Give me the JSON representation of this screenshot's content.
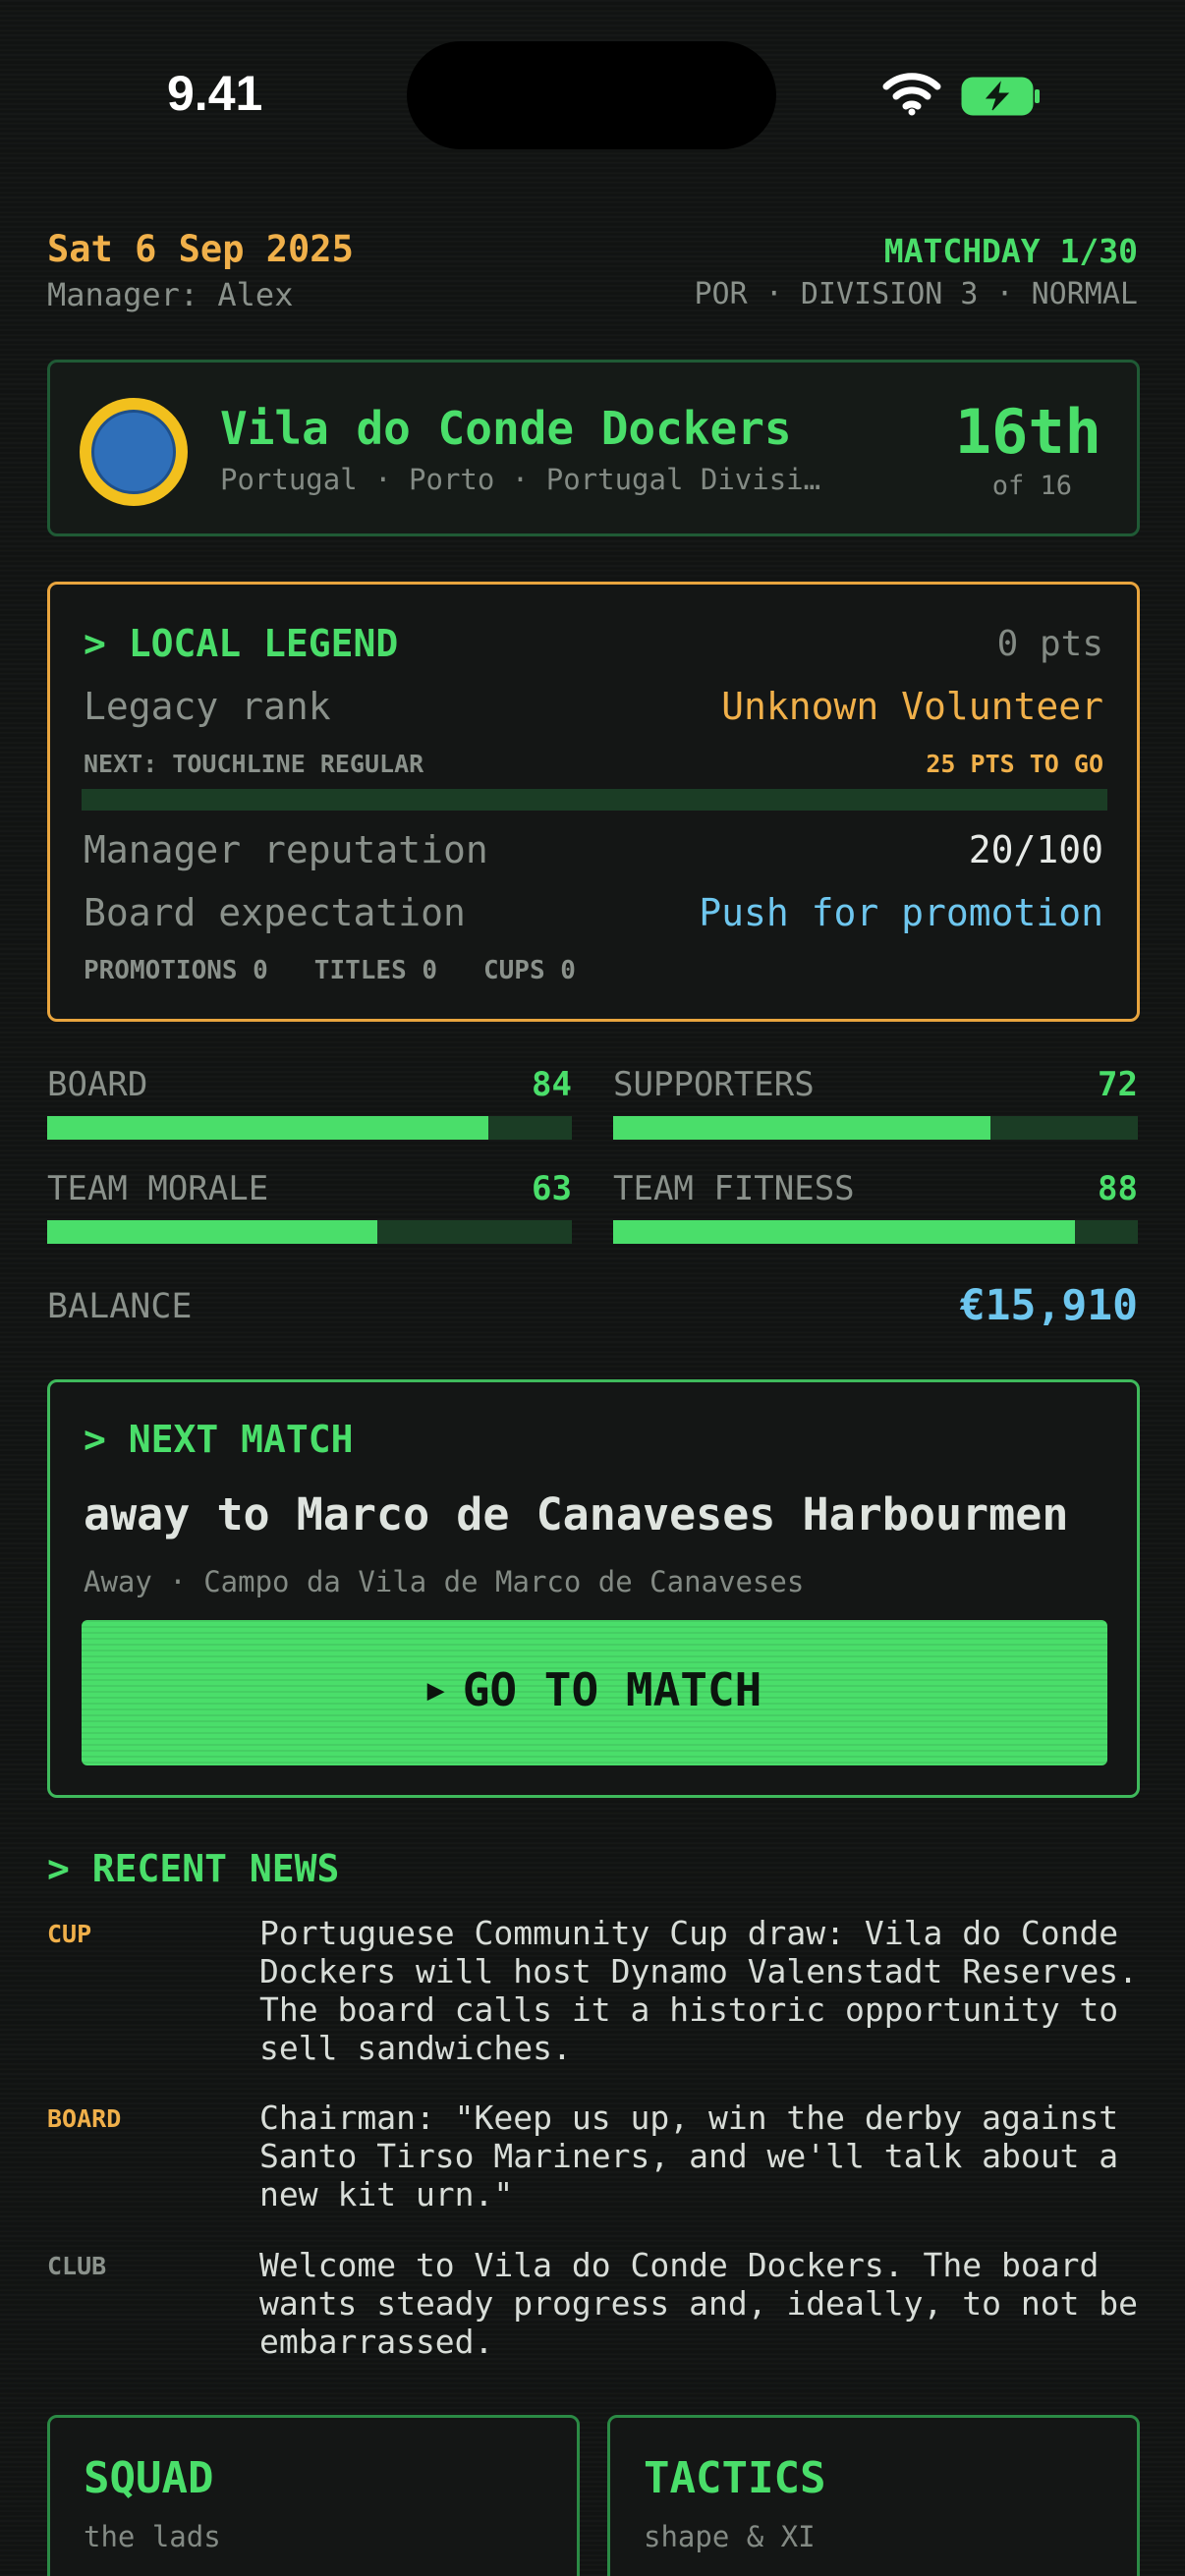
{
  "status_bar": {
    "time": "9.41"
  },
  "header": {
    "date": "Sat 6 Sep 2025",
    "manager": "Manager: Alex",
    "matchday": "MATCHDAY 1/30",
    "league_info": "POR · DIVISION 3 · NORMAL"
  },
  "club": {
    "name": "Vila do Conde Dockers",
    "subtitle": "Portugal · Porto · Portugal Divisi…",
    "position": "16th",
    "position_of": "of 16",
    "crest_colors": {
      "ring": "#f2c01d",
      "inner": "#2f6fb9"
    }
  },
  "legend": {
    "title": "> LOCAL LEGEND",
    "points": "0 pts",
    "legacy_rank_label": "Legacy rank",
    "legacy_rank_value": "Unknown Volunteer",
    "next_label": "NEXT: TOUCHLINE REGULAR",
    "to_go": "25 PTS TO GO",
    "progress_fraction": 0,
    "reputation_label": "Manager reputation",
    "reputation_value": "20/100",
    "expectation_label": "Board expectation",
    "expectation_value": "Push for promotion",
    "honours": "PROMOTIONS 0   TITLES 0   CUPS 0"
  },
  "stats": [
    {
      "label": "BOARD",
      "value": "84",
      "fraction": 0.84
    },
    {
      "label": "SUPPORTERS",
      "value": "72",
      "fraction": 0.72
    },
    {
      "label": "TEAM MORALE",
      "value": "63",
      "fraction": 0.63
    },
    {
      "label": "TEAM FITNESS",
      "value": "88",
      "fraction": 0.88
    }
  ],
  "balance": {
    "label": "BALANCE",
    "value": "€15,910"
  },
  "next_match": {
    "title": "> NEXT MATCH",
    "opponent": "away to Marco de Canaveses Harbourmen",
    "venue": "Away · Campo da Vila de Marco de Canaveses",
    "button_icon": "▶",
    "button_label": "GO TO MATCH"
  },
  "news": {
    "title": "> RECENT NEWS",
    "items": [
      {
        "tag": "CUP",
        "tag_color": "#f0b04a",
        "text": "Portuguese Community Cup draw: Vila do Conde Dockers will host Dynamo Valenstadt Reserves. The board calls it a historic opportunity to sell sandwiches."
      },
      {
        "tag": "BOARD",
        "tag_color": "#f0b04a",
        "text": "Chairman: \"Keep us up, win the derby against Santo Tirso Mariners, and we'll talk about a new kit urn.\""
      },
      {
        "tag": "CLUB",
        "tag_color": "#8a918b",
        "text": "Welcome to Vila do Conde Dockers. The board wants steady progress and, ideally, to not be embarrassed."
      }
    ]
  },
  "tiles": [
    {
      "title": "SQUAD",
      "subtitle": "the lads"
    },
    {
      "title": "TACTICS",
      "subtitle": "shape & XI"
    }
  ],
  "colors": {
    "background": "#111312",
    "accent_green": "#4ade6a",
    "accent_amber": "#f0b04a",
    "accent_blue": "#6ec6ee"
  }
}
